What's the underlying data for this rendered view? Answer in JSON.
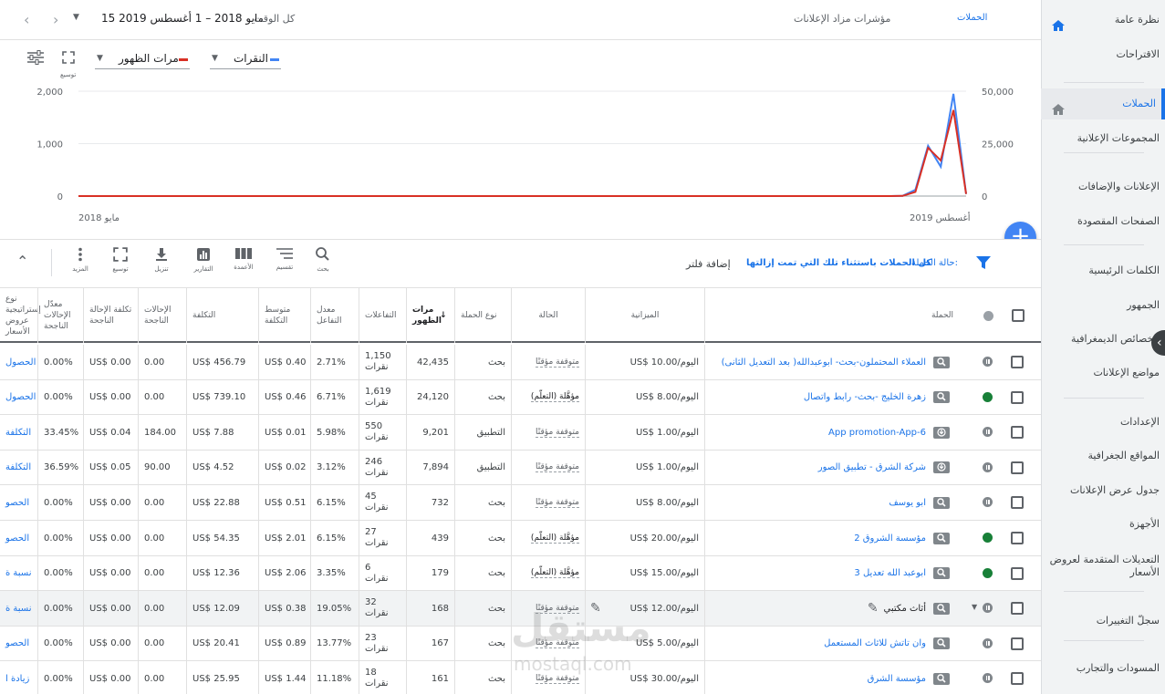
{
  "header": {
    "date_range": "15 مايو 2018 – 1 أغسطس 2019",
    "date_label": "كل الوقت",
    "page_title": "مؤشرات مزاد الإعلانات",
    "breadcrumb": "الحملات"
  },
  "sidebar": {
    "items": [
      {
        "label": "نظرة عامة",
        "active": false,
        "home": true
      },
      {
        "label": "الاقتراحات"
      },
      {
        "label": "الحملات",
        "active": true,
        "home": true
      },
      {
        "label": "المجموعات الإعلانية"
      },
      {
        "label": "الإعلانات والإضافات"
      },
      {
        "label": "الصفحات المقصودة"
      },
      {
        "label": "الكلمات الرئيسية"
      },
      {
        "label": "الجمهور"
      },
      {
        "label": "الخصائص الديمغرافية"
      },
      {
        "label": "مواضع الإعلانات"
      },
      {
        "label": "الإعدادات"
      },
      {
        "label": "المواقع الجغرافية"
      },
      {
        "label": "جدول عرض الإعلانات"
      },
      {
        "label": "الأجهزة"
      },
      {
        "label": "التعديلات المتقدمة لعروض الأسعار"
      },
      {
        "label": "سجلّ التغييرات"
      },
      {
        "label": "المسودات والتجارب"
      }
    ]
  },
  "chart_controls": {
    "metric1": "النقرات",
    "metric2": "مرات الظهور",
    "expand_label": "توسيع"
  },
  "chart_data": {
    "type": "line",
    "x_start_label": "مايو 2018",
    "x_end_label": "أغسطس 2019",
    "left_axis": {
      "ticks": [
        "0",
        "1,000",
        "2,000"
      ],
      "max": 2000
    },
    "right_axis": {
      "ticks": [
        "0",
        "25,000",
        "50,000"
      ],
      "max": 50000
    },
    "series": [
      {
        "name": "النقرات",
        "color": "#4285f4",
        "axis": "left",
        "values": [
          0,
          0,
          0,
          0,
          0,
          0,
          0,
          0,
          0,
          0,
          0,
          0,
          0,
          0,
          0,
          0,
          0,
          0,
          0,
          0,
          0,
          0,
          0,
          0,
          0,
          0,
          0,
          0,
          0,
          0,
          0,
          0,
          0,
          0,
          0,
          0,
          0,
          0,
          0,
          0,
          0,
          0,
          0,
          0,
          0,
          0,
          0,
          0,
          0,
          0,
          0,
          0,
          0,
          0,
          0,
          0,
          0,
          0,
          0,
          0,
          0,
          0,
          0,
          0,
          0,
          5,
          120,
          960,
          560,
          1950,
          40
        ]
      },
      {
        "name": "مرات الظهور",
        "color": "#d93025",
        "axis": "right",
        "values": [
          0,
          0,
          0,
          0,
          0,
          0,
          0,
          0,
          0,
          0,
          0,
          0,
          0,
          0,
          0,
          0,
          0,
          0,
          0,
          0,
          0,
          0,
          0,
          0,
          0,
          0,
          0,
          0,
          0,
          0,
          0,
          0,
          0,
          0,
          0,
          0,
          0,
          0,
          0,
          0,
          0,
          0,
          0,
          0,
          0,
          0,
          0,
          0,
          0,
          0,
          0,
          0,
          0,
          0,
          0,
          0,
          0,
          0,
          0,
          0,
          0,
          0,
          0,
          0,
          0,
          100,
          2000,
          23000,
          17000,
          41000,
          1000
        ]
      }
    ]
  },
  "toolbar": {
    "filter_status_label": "حالة الحملة:",
    "filter_status_value": "كل الحملات باستثناء تلك التي تمت إزالتها",
    "add_filter": "إضافة فلتر",
    "search": "بحث",
    "segment": "تقسيم",
    "columns": "الأعمدة",
    "reports": "التقارير",
    "download": "تنزيل",
    "expand": "توسيع",
    "more": "المزيد"
  },
  "table": {
    "headers": {
      "campaign": "الحملة",
      "budget": "الميزانية",
      "status": "الحالة",
      "type": "نوع الحملة",
      "impr": "مرات الظهور",
      "interactions": "التفاعلات",
      "int_rate": "معدل التفاعل",
      "avg_cost": "متوسط التكلفة",
      "cost": "التكلفة",
      "conv": "الإحالات الناجحة",
      "cost_conv": "تكلفة الإحالة الناجحة",
      "conv_rate": "معدّل الإحالات الناجحة",
      "bid": "نوع إستراتيجية عروض الأسعار"
    },
    "rows": [
      {
        "name": "العملاء المحتملون-بحث- ابوعبدالله( بعد التعديل الثانى)",
        "budget": "US$ 10.00/اليوم",
        "status": "متوقفة مؤقتًا",
        "type": "بحث",
        "impr": "42,435",
        "int1": "1,150",
        "int2": "نقرات",
        "rate": "2.71%",
        "avg": "US$ 0.40",
        "cost": "US$ 456.79",
        "conv": "0.00",
        "cpc": "US$ 0.00",
        "crate": "0.00%",
        "bid": "الحصول",
        "state": "pause",
        "icon": "search"
      },
      {
        "name": "زهرة الخليج -بحث- رابط واتصال",
        "budget": "US$ 8.00/اليوم",
        "status": "مؤهَّلة (التعلّم)",
        "type": "بحث",
        "impr": "24,120",
        "int1": "1,619",
        "int2": "نقرات",
        "rate": "6.71%",
        "avg": "US$ 0.46",
        "cost": "US$ 739.10",
        "conv": "0.00",
        "cpc": "US$ 0.00",
        "crate": "0.00%",
        "bid": "الحصول",
        "state": "green",
        "icon": "search"
      },
      {
        "name": "App promotion-App-6",
        "budget": "US$ 1.00/اليوم",
        "status": "متوقفة مؤقتًا",
        "type": "التطبيق",
        "impr": "9,201",
        "int1": "550",
        "int2": "نقرات",
        "rate": "5.98%",
        "avg": "US$ 0.01",
        "cost": "US$ 7.88",
        "conv": "184.00",
        "cpc": "US$ 0.04",
        "crate": "33.45%",
        "bid": "التكلفة",
        "state": "pause",
        "icon": "app"
      },
      {
        "name": "شركة الشرق - تطبيق الصور",
        "budget": "US$ 1.00/اليوم",
        "status": "متوقفة مؤقتًا",
        "type": "التطبيق",
        "impr": "7,894",
        "int1": "246",
        "int2": "نقرات",
        "rate": "3.12%",
        "avg": "US$ 0.02",
        "cost": "US$ 4.52",
        "conv": "90.00",
        "cpc": "US$ 0.05",
        "crate": "36.59%",
        "bid": "التكلفة",
        "state": "pause",
        "icon": "app"
      },
      {
        "name": "ابو يوسف",
        "budget": "US$ 8.00/اليوم",
        "status": "متوقفة مؤقتًا",
        "type": "بحث",
        "impr": "732",
        "int1": "45",
        "int2": "نقرات",
        "rate": "6.15%",
        "avg": "US$ 0.51",
        "cost": "US$ 22.88",
        "conv": "0.00",
        "cpc": "US$ 0.00",
        "crate": "0.00%",
        "bid": "الحصو",
        "state": "pause",
        "icon": "search"
      },
      {
        "name": "مؤسسة الشروق 2",
        "budget": "US$ 20.00/اليوم",
        "status": "مؤهَّلة (التعلّم)",
        "type": "بحث",
        "impr": "439",
        "int1": "27",
        "int2": "نقرات",
        "rate": "6.15%",
        "avg": "US$ 2.01",
        "cost": "US$ 54.35",
        "conv": "0.00",
        "cpc": "US$ 0.00",
        "crate": "0.00%",
        "bid": "الحصو",
        "state": "green",
        "icon": "search"
      },
      {
        "name": "ابوعبد الله تعديل 3",
        "budget": "US$ 15.00/اليوم",
        "status": "مؤهَّلة (التعلّم)",
        "type": "بحث",
        "impr": "179",
        "int1": "6",
        "int2": "نقرات",
        "rate": "3.35%",
        "avg": "US$ 2.06",
        "cost": "US$ 12.36",
        "conv": "0.00",
        "cpc": "US$ 0.00",
        "crate": "0.00%",
        "bid": "نسبة ة",
        "state": "green",
        "icon": "search"
      },
      {
        "name": "أثاث مكتبي",
        "budget": "US$ 12.00/اليوم",
        "status": "متوقفة مؤقتًا",
        "type": "بحث",
        "impr": "168",
        "int1": "32",
        "int2": "نقرات",
        "rate": "19.05%",
        "avg": "US$ 0.38",
        "cost": "US$ 12.09",
        "conv": "0.00",
        "cpc": "US$ 0.00",
        "crate": "0.00%",
        "bid": "نسبة ة",
        "state": "pause",
        "icon": "search",
        "hl": true
      },
      {
        "name": "وان تاتش للاثاث المستعمل",
        "budget": "US$ 5.00/اليوم",
        "status": "متوقفة مؤقتًا",
        "type": "بحث",
        "impr": "167",
        "int1": "23",
        "int2": "نقرات",
        "rate": "13.77%",
        "avg": "US$ 0.89",
        "cost": "US$ 20.41",
        "conv": "0.00",
        "cpc": "US$ 0.00",
        "crate": "0.00%",
        "bid": "الحصو",
        "state": "pause",
        "icon": "search"
      },
      {
        "name": "مؤسسة الشرق",
        "budget": "US$ 30.00/اليوم",
        "status": "متوقفة مؤقتًا",
        "type": "بحث",
        "impr": "161",
        "int1": "18",
        "int2": "نقرات",
        "rate": "11.18%",
        "avg": "US$ 1.44",
        "cost": "US$ 25.95",
        "conv": "0.00",
        "cpc": "US$ 0.00",
        "crate": "0.00%",
        "bid": "زيادة ا",
        "state": "pause",
        "icon": "search"
      }
    ]
  }
}
